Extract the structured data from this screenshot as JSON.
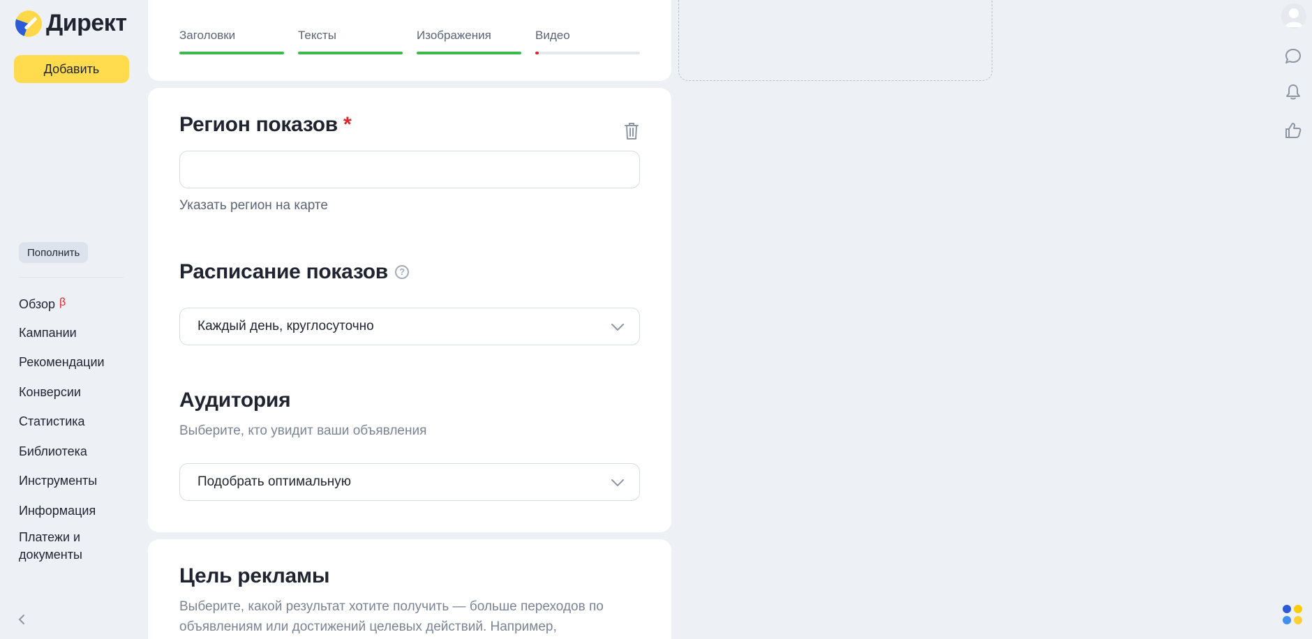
{
  "app": {
    "name": "Директ"
  },
  "sidebar": {
    "add_label": "Добавить",
    "topup_label": "Пополнить",
    "nav": [
      {
        "label": "Обзор",
        "badge": "β"
      },
      {
        "label": "Кампании"
      },
      {
        "label": "Рекомендации"
      },
      {
        "label": "Конверсии"
      },
      {
        "label": "Статистика"
      },
      {
        "label": "Библиотека"
      },
      {
        "label": "Инструменты"
      },
      {
        "label": "Информация"
      },
      {
        "label": "Платежи и документы"
      }
    ]
  },
  "tabs": [
    {
      "label": "Заголовки",
      "progress": 1.0,
      "color": "#3dba4f"
    },
    {
      "label": "Тексты",
      "progress": 1.0,
      "color": "#3dba4f"
    },
    {
      "label": "Изображения",
      "progress": 1.0,
      "color": "#3dba4f"
    },
    {
      "label": "Видео",
      "progress": 0.03,
      "color": "#e0242a"
    }
  ],
  "region": {
    "title": "Регион показов",
    "required_mark": "*",
    "input_value": "",
    "map_link": "Указать регион на карте"
  },
  "schedule": {
    "title": "Расписание показов",
    "help": "?",
    "value": "Каждый день, круглосуточно"
  },
  "audience": {
    "title": "Аудитория",
    "subtitle": "Выберите, кто увидит ваши объявления",
    "value": "Подобрать оптимальную"
  },
  "goal": {
    "title": "Цель рекламы",
    "description": "Выберите, какой результат хотите получить — больше переходов по объявлениям или достижений целевых действий. Например,"
  },
  "colors": {
    "accent_yellow": "#ffdb4d",
    "progress_complete": "#3dba4f",
    "progress_incomplete": "#e0242a",
    "required": "#e0242a",
    "background": "#edf0f5"
  },
  "icons": [
    "logo-icon",
    "trash-icon",
    "help-icon",
    "chevron-down-icon",
    "avatar-icon",
    "chat-icon",
    "bell-icon",
    "thumbs-up-icon",
    "apps-icon",
    "chevron-left-icon"
  ]
}
